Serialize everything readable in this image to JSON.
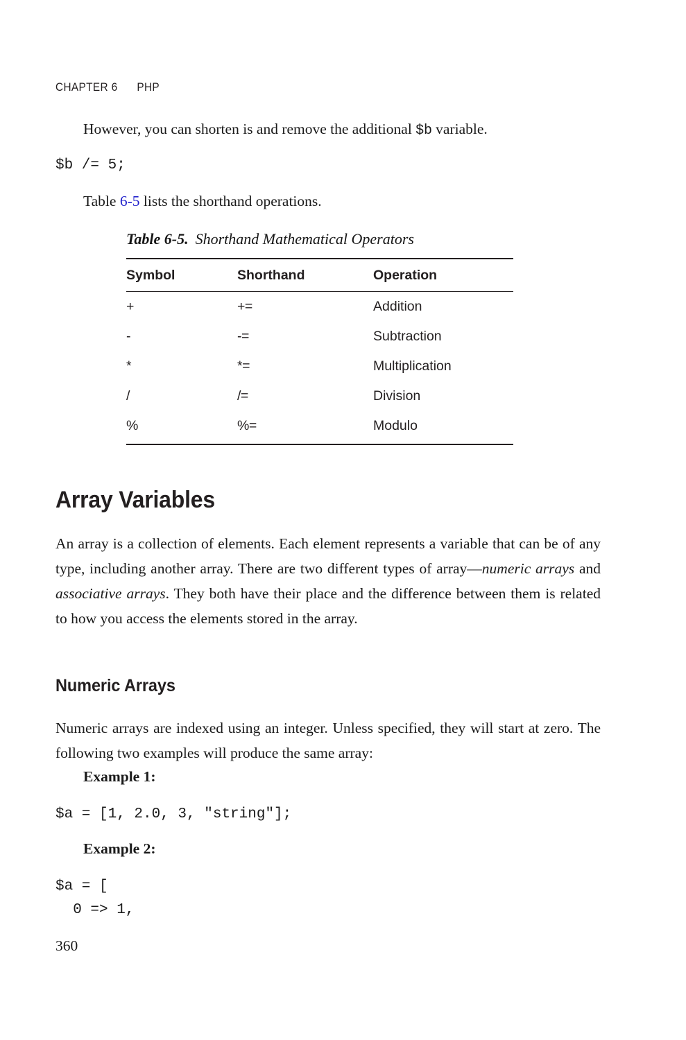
{
  "page": {
    "number": "360",
    "running_head": {
      "chapter": "CHAPTER 6",
      "title": "PHP"
    },
    "link_color": "#2222cc"
  },
  "paragraphs": {
    "however": {
      "before": "However, you can shorten is and remove the additional ",
      "code": "$b",
      "after": " variable."
    },
    "shorthand_code": "$b /= 5;",
    "table_ref": {
      "before": "Table ",
      "link": "6-5",
      "after": " lists the shorthand operations."
    }
  },
  "table": {
    "caption_label": "Table 6-5.",
    "caption_title": "Shorthand Mathematical Operators",
    "columns": [
      "Symbol",
      "Shorthand",
      "Operation"
    ],
    "rows": [
      {
        "symbol": "+",
        "shorthand": "+=",
        "operation": "Addition"
      },
      {
        "symbol": "-",
        "shorthand": "-=",
        "operation": "Subtraction"
      },
      {
        "symbol": "*",
        "shorthand": "*=",
        "operation": "Multiplication"
      },
      {
        "symbol": "/",
        "shorthand": "/=",
        "operation": "Division"
      },
      {
        "symbol": "%",
        "shorthand": "%=",
        "operation": "Modulo"
      }
    ]
  },
  "sections": {
    "array_variables": {
      "heading": "Array Variables",
      "body": {
        "part1": "An array is a collection of elements. Each element represents a variable that can be of any type, including another array. There are two different types of array—",
        "italic1": "numeric arrays",
        "part2": " and ",
        "italic2": "associative arrays",
        "part3": ". They both have their place and the difference between them is related to how you access the elements stored in the array."
      }
    },
    "numeric_arrays": {
      "heading": "Numeric Arrays",
      "body": "Numeric arrays are indexed using an integer. Unless specified, they will start at zero. The following two examples will produce the same array:",
      "example1_label": "Example 1:",
      "example1_code": "$a = [1, 2.0, 3, \"string\"];",
      "example2_label": "Example 2:",
      "example2_code_line1": "$a = [",
      "example2_code_line2": "  0 => 1,"
    }
  }
}
